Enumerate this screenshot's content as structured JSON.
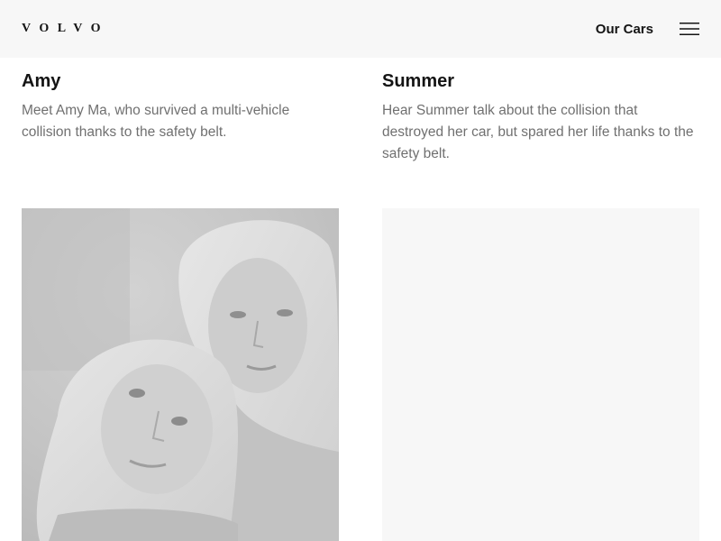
{
  "header": {
    "logo_text": "VOLVO",
    "nav_link": "Our Cars",
    "menu_icon": "hamburger-menu-icon"
  },
  "cards": [
    {
      "title": "Amy",
      "description": "Meet Amy Ma, who survived a multi-vehicle collision thanks to the safety belt."
    },
    {
      "title": "Summer",
      "description": "Hear Summer talk about the collision that destroyed her car, but spared her life thanks to the safety belt."
    }
  ],
  "colors": {
    "header_bg": "#f7f7f7",
    "text_primary": "#141414",
    "text_secondary": "#707070",
    "placeholder_bg": "#f7f7f7"
  }
}
